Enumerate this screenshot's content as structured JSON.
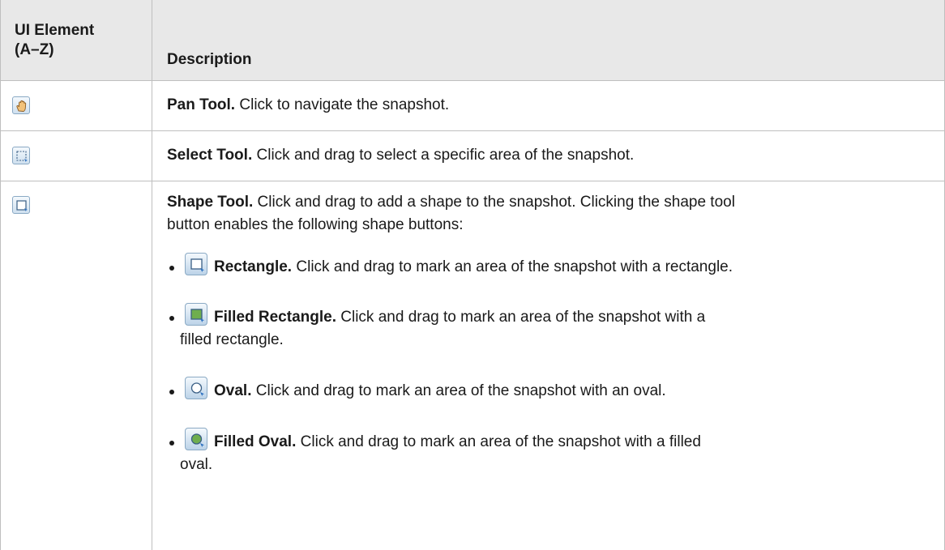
{
  "header": {
    "col1_line1": "UI Element",
    "col1_line2": "(A–Z)",
    "col2": "Description"
  },
  "rows": [
    {
      "icon": "pan-hand-icon",
      "title": "Pan Tool.",
      "text": "Click to navigate the snapshot."
    },
    {
      "icon": "select-tool-icon",
      "title": "Select Tool.",
      "text": "Click and drag to select a specific area of the snapshot."
    },
    {
      "icon": "shape-tool-icon",
      "title": "Shape Tool.",
      "text_line1": "Click and drag to add a shape to the snapshot. Clicking the shape tool",
      "text_line2": "button enables the following shape buttons:",
      "bullets": [
        {
          "icon": "rectangle-icon",
          "title": "Rectangle.",
          "text": "Click and drag to mark an area of the snapshot with a rectangle."
        },
        {
          "icon": "filled-rectangle-icon",
          "title": "Filled Rectangle.",
          "text": "Click and drag to mark an area of the snapshot with a",
          "text_cont": "filled rectangle."
        },
        {
          "icon": "oval-icon",
          "title": "Oval.",
          "text": "Click and drag to mark an area of the snapshot with an oval."
        },
        {
          "icon": "filled-oval-icon",
          "title": "Filled Oval.",
          "text": "Click and drag to mark an area of the snapshot with a filled",
          "text_cont": "oval."
        }
      ]
    }
  ]
}
